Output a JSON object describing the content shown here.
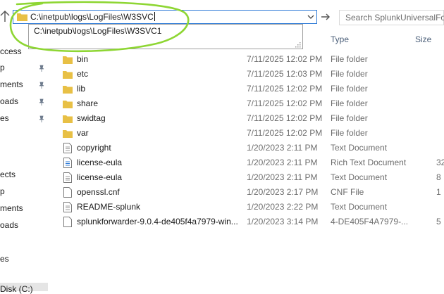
{
  "address_bar": {
    "path": "C:\\inetpub\\logs\\LogFiles\\W3SVC",
    "suggestion": "C:\\inetpub\\logs\\LogFiles\\W3SVC1"
  },
  "search": {
    "placeholder": "Search SplunkUniversalFor"
  },
  "columns": {
    "type": "Type",
    "size": "Size"
  },
  "nav_items": [
    "ccess",
    "p",
    "ments",
    "oads",
    "es",
    "ects",
    "p",
    "ments",
    "oads",
    "es",
    "Disk (C:)"
  ],
  "files": [
    {
      "name": "bin",
      "date": "7/11/2025 12:02 PM",
      "type": "File folder",
      "size": "",
      "icon": "folder-icon"
    },
    {
      "name": "etc",
      "date": "7/11/2025 12:03 PM",
      "type": "File folder",
      "size": "",
      "icon": "folder-icon"
    },
    {
      "name": "lib",
      "date": "7/11/2025 12:02 PM",
      "type": "File folder",
      "size": "",
      "icon": "folder-icon"
    },
    {
      "name": "share",
      "date": "7/11/2025 12:02 PM",
      "type": "File folder",
      "size": "",
      "icon": "folder-icon"
    },
    {
      "name": "swidtag",
      "date": "7/11/2025 12:02 PM",
      "type": "File folder",
      "size": "",
      "icon": "folder-icon"
    },
    {
      "name": "var",
      "date": "7/11/2025 12:02 PM",
      "type": "File folder",
      "size": "",
      "icon": "folder-icon"
    },
    {
      "name": "copyright",
      "date": "1/20/2023 2:11 PM",
      "type": "Text Document",
      "size": "",
      "icon": "text-document-icon"
    },
    {
      "name": "license-eula",
      "date": "1/20/2023 2:11 PM",
      "type": "Rich Text Document",
      "size": "32",
      "icon": "rich-text-document-icon"
    },
    {
      "name": "license-eula",
      "date": "1/20/2023 2:11 PM",
      "type": "Text Document",
      "size": "8",
      "icon": "text-document-icon"
    },
    {
      "name": "openssl.cnf",
      "date": "1/20/2023 2:17 PM",
      "type": "CNF File",
      "size": "1",
      "icon": "blank-file-icon"
    },
    {
      "name": "README-splunk",
      "date": "1/20/2023 2:22 PM",
      "type": "Text Document",
      "size": "",
      "icon": "text-document-icon"
    },
    {
      "name": "splunkforwarder-9.0.4-de405f4a7979-win...",
      "date": "1/20/2023 3:14 PM",
      "type": "4-DE405F4A7979-...",
      "size": "5",
      "icon": "blank-file-icon"
    }
  ],
  "colors": {
    "folder": "#e8c045",
    "accent": "#2b79d6",
    "annotation": "#8ed633"
  }
}
